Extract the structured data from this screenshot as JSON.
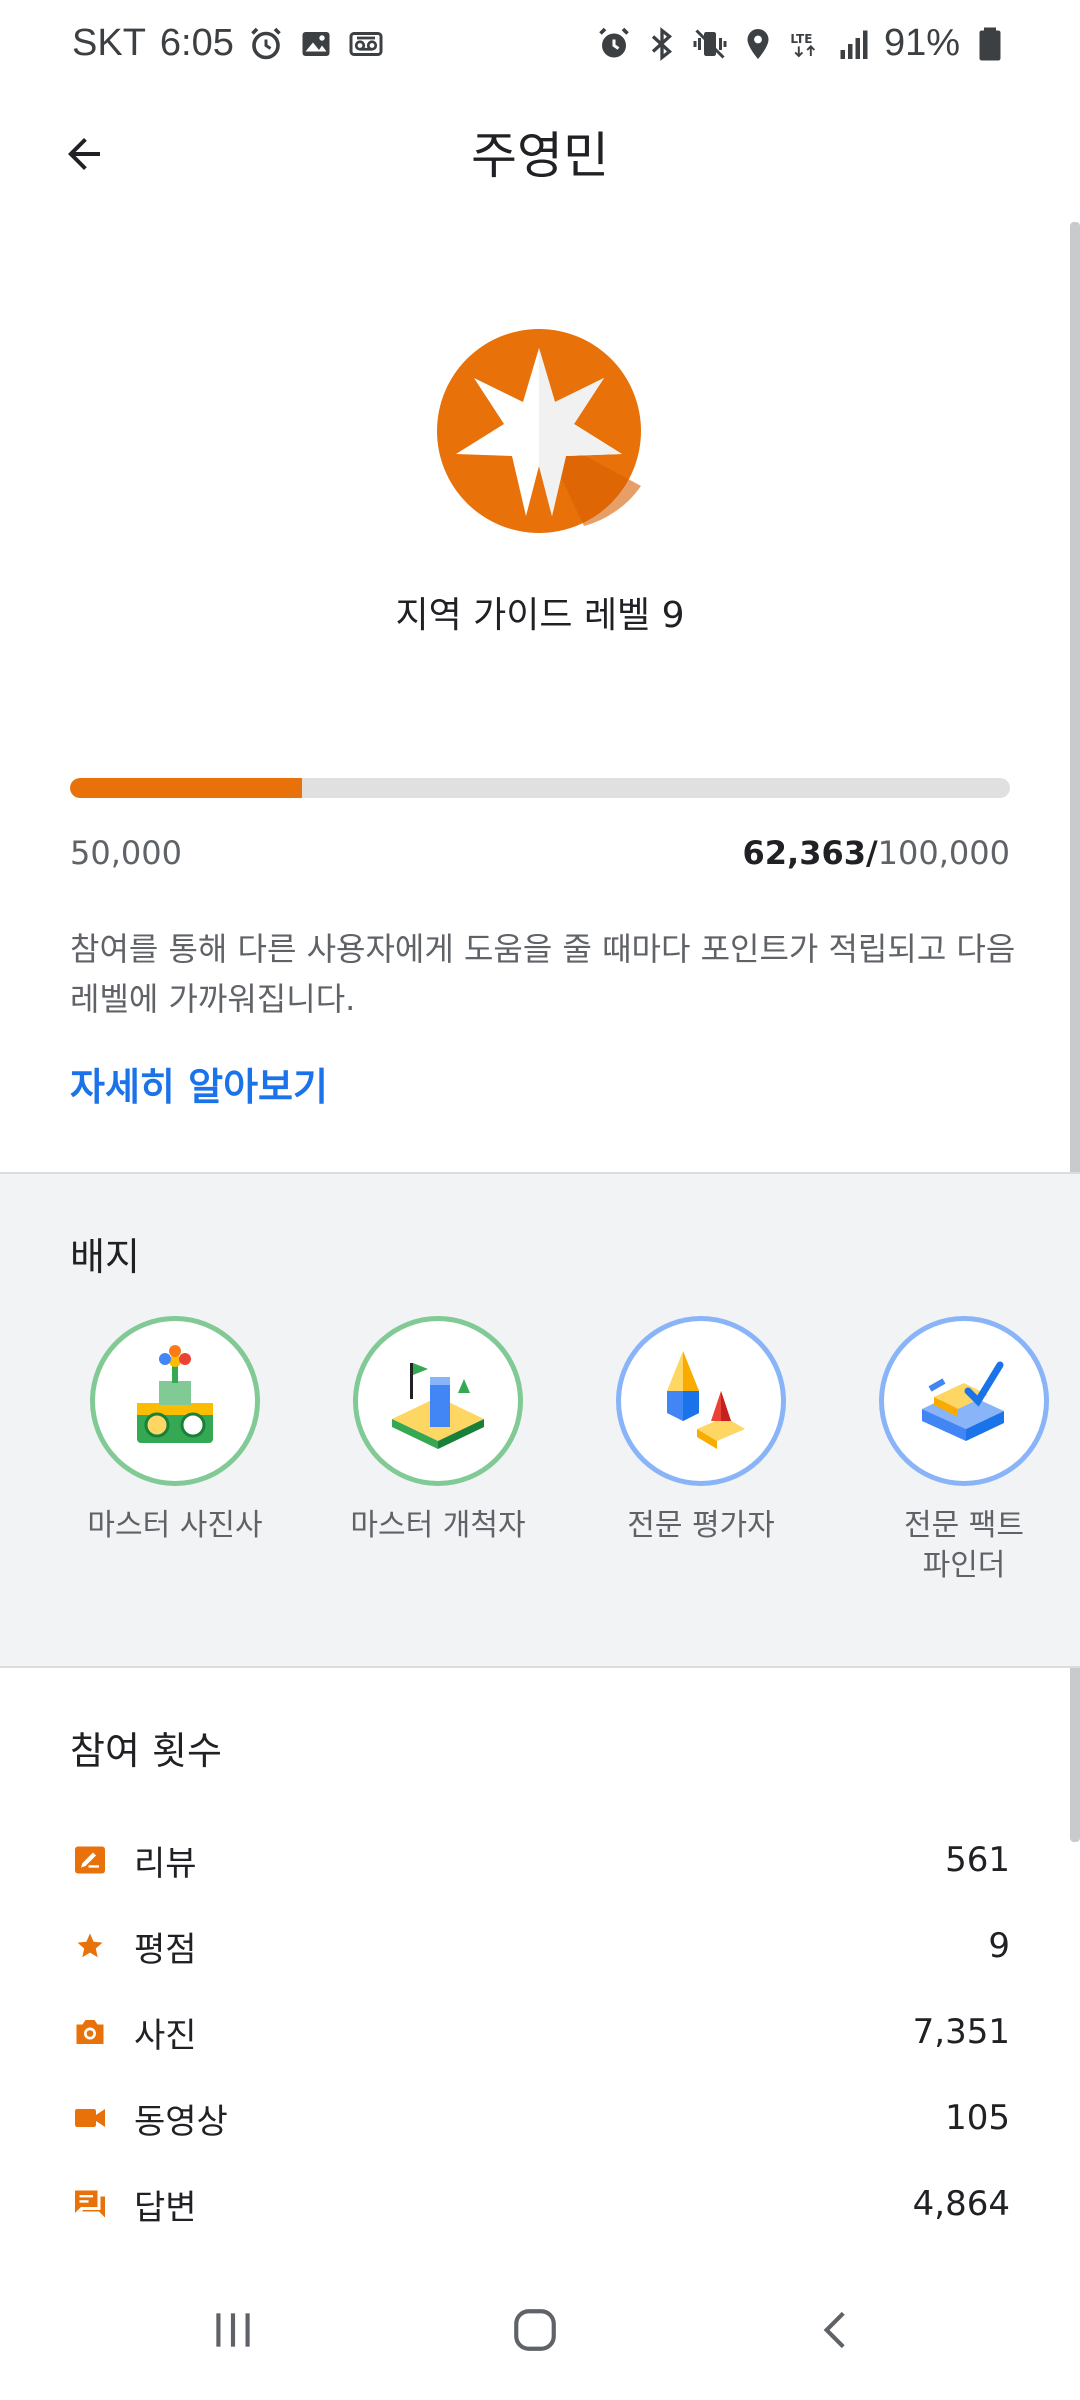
{
  "status_bar": {
    "carrier": "SKT",
    "time": "6:05",
    "network": "LTE",
    "battery": "91%",
    "left_icons": [
      "alarm-icon",
      "gallery-icon",
      "voicemail-icon"
    ],
    "right_icons": [
      "alarm-icon",
      "bluetooth-icon",
      "vibrate-icon",
      "location-icon",
      "lte-icon",
      "signal-icon",
      "battery-icon"
    ]
  },
  "header": {
    "title": "주영민",
    "back_icon": "arrow-left-icon"
  },
  "level": {
    "title": "지역 가이드 레벨 9",
    "badge_icon": "star-level-badge-icon",
    "badge_color": "#e8710a",
    "progress_min": "50,000",
    "progress_current": "62,363",
    "progress_separator": "/",
    "progress_max": "100,000",
    "progress_fraction": 0.24726,
    "description": "참여를 통해 다른 사용자에게 도움을 줄 때마다 포인트가 적립되고 다음 레벨에 가까워집니다.",
    "learn_more": "자세히 알아보기"
  },
  "badges": {
    "heading": "배지",
    "items": [
      {
        "label": "마스터 사진사",
        "ring": "green",
        "icon": "camera-flower-badge-icon"
      },
      {
        "label": "마스터 개척자",
        "ring": "green",
        "icon": "flag-path-badge-icon"
      },
      {
        "label": "전문 평가자",
        "ring": "blue",
        "icon": "pencil-blocks-badge-icon"
      },
      {
        "label": "전문 팩트\n파인더",
        "ring": "blue",
        "icon": "check-blocks-badge-icon"
      }
    ]
  },
  "contributions": {
    "heading": "참여 횟수",
    "accent_color": "#e8710a",
    "items": [
      {
        "label": "리뷰",
        "value": "561",
        "icon": "review-icon"
      },
      {
        "label": "평점",
        "value": "9",
        "icon": "star-icon"
      },
      {
        "label": "사진",
        "value": "7,351",
        "icon": "camera-icon"
      },
      {
        "label": "동영상",
        "value": "105",
        "icon": "video-icon"
      },
      {
        "label": "답변",
        "value": "4,864",
        "icon": "answer-icon"
      }
    ]
  },
  "nav": {
    "icons": [
      "recent-apps-icon",
      "home-icon",
      "back-icon"
    ]
  }
}
